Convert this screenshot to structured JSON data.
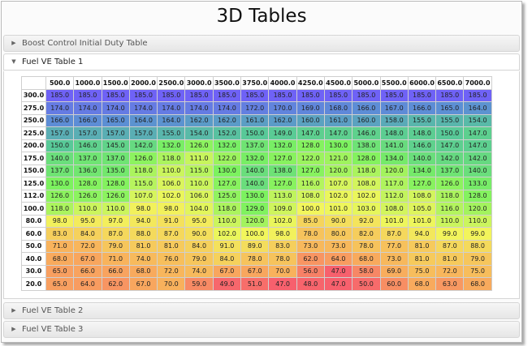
{
  "page": {
    "title": "3D Tables"
  },
  "accordion": [
    {
      "label": "Boost Control Initial Duty Table",
      "icon": "triangle-right-icon",
      "open": false
    },
    {
      "label": "Fuel VE Table 1",
      "icon": "triangle-down-icon",
      "open": true
    },
    {
      "label": "Fuel VE Table 2",
      "icon": "triangle-right-icon",
      "open": false
    },
    {
      "label": "Fuel VE Table 3",
      "icon": "triangle-right-icon",
      "open": false
    }
  ],
  "ve_table": {
    "columns": [
      "500.0",
      "1000.0",
      "1500.0",
      "2000.0",
      "2500.0",
      "3000.0",
      "3500.0",
      "3750.0",
      "4000.0",
      "4250.0",
      "4500.0",
      "5000.0",
      "5500.0",
      "6000.0",
      "6500.0",
      "7000.0"
    ],
    "rows": [
      "300.0",
      "275.0",
      "250.0",
      "225.0",
      "200.0",
      "175.0",
      "150.0",
      "125.0",
      "112.0",
      "100.0",
      "80.0",
      "60.0",
      "50.0",
      "40.0",
      "30.0",
      "20.0"
    ],
    "cells": [
      [
        "185.0",
        "185.0",
        "185.0",
        "185.0",
        "185.0",
        "185.0",
        "185.0",
        "185.0",
        "185.0",
        "185.0",
        "185.0",
        "185.0",
        "185.0",
        "185.0",
        "185.0",
        "185.0"
      ],
      [
        "174.0",
        "174.0",
        "174.0",
        "174.0",
        "174.0",
        "174.0",
        "174.0",
        "172.0",
        "170.0",
        "169.0",
        "168.0",
        "166.0",
        "167.0",
        "166.0",
        "165.0",
        "164.0"
      ],
      [
        "166.0",
        "166.0",
        "165.0",
        "164.0",
        "164.0",
        "162.0",
        "162.0",
        "161.0",
        "162.0",
        "160.0",
        "161.0",
        "160.0",
        "158.0",
        "155.0",
        "155.0",
        "154.0"
      ],
      [
        "157.0",
        "157.0",
        "157.0",
        "157.0",
        "155.0",
        "154.0",
        "152.0",
        "150.0",
        "149.0",
        "147.0",
        "147.0",
        "146.0",
        "148.0",
        "148.0",
        "150.0",
        "147.0"
      ],
      [
        "150.0",
        "146.0",
        "145.0",
        "142.0",
        "132.0",
        "126.0",
        "132.0",
        "137.0",
        "132.0",
        "128.0",
        "130.0",
        "138.0",
        "141.0",
        "146.0",
        "147.0",
        "147.0"
      ],
      [
        "140.0",
        "137.0",
        "137.0",
        "126.0",
        "118.0",
        "111.0",
        "122.0",
        "132.0",
        "127.0",
        "122.0",
        "121.0",
        "128.0",
        "134.0",
        "140.0",
        "142.0",
        "142.0"
      ],
      [
        "137.0",
        "136.0",
        "135.0",
        "118.0",
        "110.0",
        "115.0",
        "130.0",
        "140.0",
        "138.0",
        "127.0",
        "120.0",
        "118.0",
        "120.0",
        "134.0",
        "137.0",
        "140.0"
      ],
      [
        "130.0",
        "128.0",
        "128.0",
        "115.0",
        "106.0",
        "110.0",
        "127.0",
        "140.0",
        "127.0",
        "116.0",
        "107.0",
        "108.0",
        "117.0",
        "127.0",
        "126.0",
        "133.0"
      ],
      [
        "126.0",
        "126.0",
        "126.0",
        "107.0",
        "102.0",
        "106.0",
        "125.0",
        "130.0",
        "113.0",
        "108.0",
        "102.0",
        "102.0",
        "112.0",
        "108.0",
        "118.0",
        "128.0"
      ],
      [
        "118.0",
        "110.0",
        "110.0",
        "98.0",
        "98.0",
        "104.0",
        "118.0",
        "129.0",
        "109.0",
        "100.0",
        "101.0",
        "103.0",
        "108.0",
        "105.0",
        "116.0",
        "120.0"
      ],
      [
        "98.0",
        "95.0",
        "97.0",
        "94.0",
        "91.0",
        "95.0",
        "110.0",
        "120.0",
        "102.0",
        "85.0",
        "90.0",
        "92.0",
        "101.0",
        "101.0",
        "110.0",
        "110.0"
      ],
      [
        "83.0",
        "84.0",
        "87.0",
        "88.0",
        "87.0",
        "90.0",
        "102.0",
        "100.0",
        "98.0",
        "78.0",
        "80.0",
        "82.0",
        "87.0",
        "94.0",
        "99.0",
        "99.0"
      ],
      [
        "71.0",
        "72.0",
        "79.0",
        "81.0",
        "81.0",
        "84.0",
        "91.0",
        "89.0",
        "83.0",
        "73.0",
        "73.0",
        "78.0",
        "77.0",
        "81.0",
        "87.0",
        "88.0"
      ],
      [
        "68.0",
        "67.0",
        "71.0",
        "74.0",
        "76.0",
        "79.0",
        "84.0",
        "78.0",
        "78.0",
        "62.0",
        "64.0",
        "68.0",
        "73.0",
        "81.0",
        "81.0",
        "79.0"
      ],
      [
        "65.0",
        "66.0",
        "66.0",
        "68.0",
        "72.0",
        "74.0",
        "67.0",
        "67.0",
        "70.0",
        "56.0",
        "47.0",
        "58.0",
        "69.0",
        "75.0",
        "72.0",
        "75.0"
      ],
      [
        "65.0",
        "64.0",
        "62.0",
        "67.0",
        "70.0",
        "59.0",
        "49.0",
        "51.0",
        "47.0",
        "48.0",
        "47.0",
        "50.0",
        "60.0",
        "68.0",
        "63.0",
        "68.0"
      ]
    ],
    "color_scale": {
      "stops": [
        {
          "value": 47,
          "color": "#f7606d"
        },
        {
          "value": 70,
          "color": "#f8b15c"
        },
        {
          "value": 100,
          "color": "#f2f65c"
        },
        {
          "value": 130,
          "color": "#7cf25f"
        },
        {
          "value": 150,
          "color": "#58c998"
        },
        {
          "value": 165,
          "color": "#5c8fd4"
        },
        {
          "value": 185,
          "color": "#6f62f6"
        }
      ]
    }
  }
}
